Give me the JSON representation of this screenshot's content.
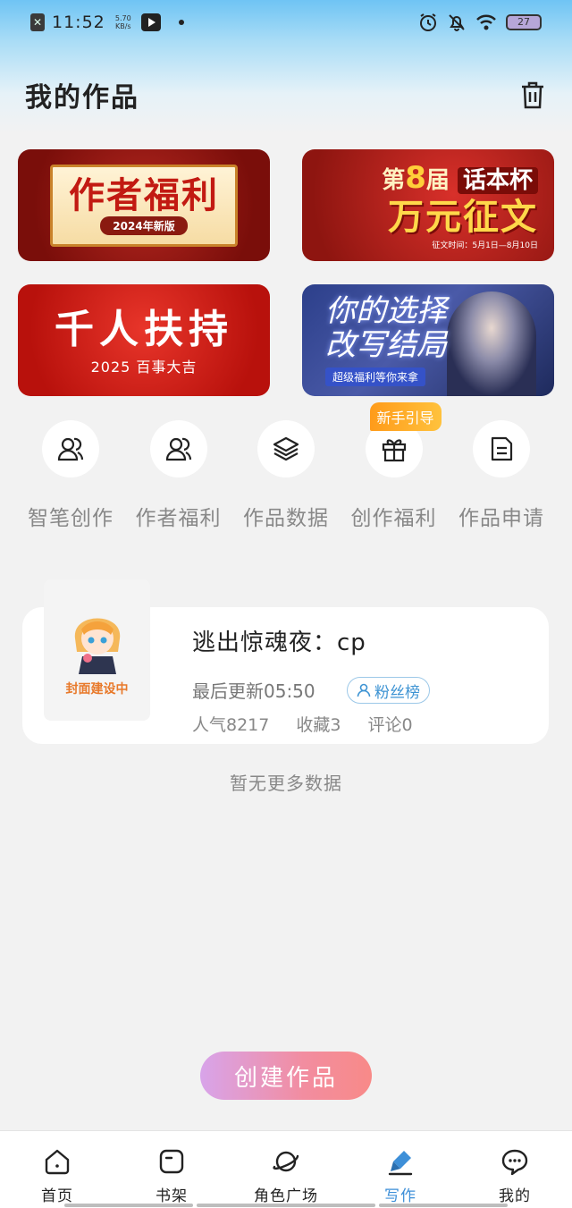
{
  "status_bar": {
    "time": "11:52",
    "speed": "5.70 KB/s",
    "battery": "27"
  },
  "header": {
    "title": "我的作品"
  },
  "banners": [
    {
      "title": "作者福利",
      "subtitle": "2024年新版"
    },
    {
      "prefix": "第",
      "number": "8",
      "suffix": "届",
      "cup": "话本杯",
      "title": "万元征文",
      "note": "征文时间：5月1日—8月10日"
    },
    {
      "title": "千人扶持",
      "subtitle": "2025 百事大吉"
    },
    {
      "title_line1": "你的选择",
      "title_line2": "改写结局",
      "subtitle": "超级福利等你来拿"
    }
  ],
  "features": [
    {
      "label": "智笔创作",
      "icon": "users-icon"
    },
    {
      "label": "作者福利",
      "icon": "users-icon"
    },
    {
      "label": "作品数据",
      "icon": "layers-icon"
    },
    {
      "label": "创作福利",
      "icon": "gift-icon"
    },
    {
      "label": "作品申请",
      "icon": "document-icon"
    }
  ],
  "guide_badge": "新手引导",
  "work": {
    "cover_text": "封面建设中",
    "title": "逃出惊魂夜：cp",
    "update": "最后更新05:50",
    "fans_tag": "粉丝榜",
    "popularity": "人气8217",
    "favorites": "收藏3",
    "comments": "评论0"
  },
  "no_more": "暂无更多数据",
  "create_button": "创建作品",
  "nav": [
    {
      "label": "首页",
      "icon": "home-icon"
    },
    {
      "label": "书架",
      "icon": "bookshelf-icon"
    },
    {
      "label": "角色广场",
      "icon": "planet-icon"
    },
    {
      "label": "写作",
      "icon": "pen-icon"
    },
    {
      "label": "我的",
      "icon": "chat-icon"
    }
  ],
  "colors": {
    "accent": "#3d8fd8",
    "create_start": "#d8a4ea",
    "create_end": "#f88a88",
    "badge": "#ffa726"
  }
}
